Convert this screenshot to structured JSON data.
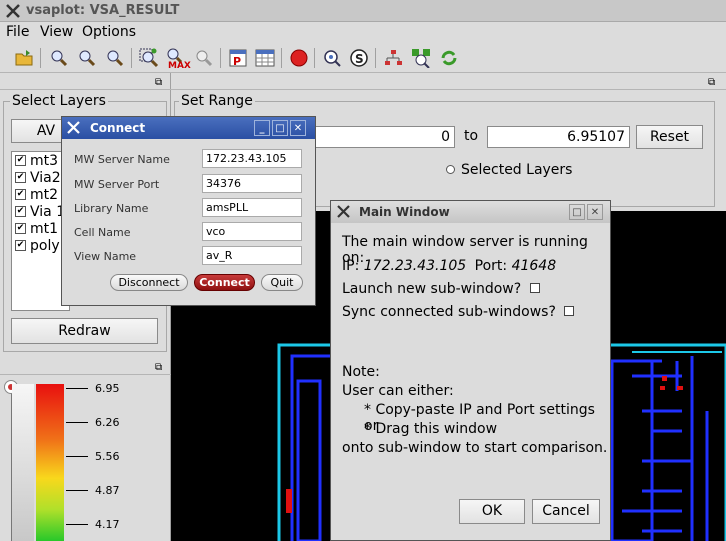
{
  "window": {
    "title": "vsaplot: VSA_RESULT"
  },
  "menu": [
    "File",
    "View",
    "Options"
  ],
  "toolbar": [
    "open-icon",
    "zoom-in-icon",
    "zoom-out-icon",
    "zoom-fit-icon",
    "zoom-area-icon",
    "zoom-max-icon",
    "zoom-prev-icon",
    "print-icon",
    "table-icon",
    "stop-icon",
    "find-icon",
    "select-icon",
    "hierarchy-icon",
    "connect-icon",
    "refresh-icon"
  ],
  "toolbar_max_label": "MAX",
  "left_panel": {
    "title": "Select Layers",
    "av_button": "AV",
    "layers": [
      "mt3",
      "Via2",
      "mt2",
      "Via 1",
      "mt1",
      "poly"
    ],
    "redraw_button": "Redraw"
  },
  "right_panel": {
    "title": "Set Range",
    "from_value": "0",
    "to_label": "to",
    "to_value": "6.95107",
    "reset_button": "Reset",
    "selected_layers_label": "Selected Layers"
  },
  "color_scale": {
    "ticks": [
      "6.95",
      "6.26",
      "5.56",
      "4.87",
      "4.17"
    ]
  },
  "connect_dialog": {
    "title": "Connect",
    "fields": [
      {
        "label": "MW Server Name",
        "value": "172.23.43.105"
      },
      {
        "label": "MW Server Port",
        "value": "34376"
      },
      {
        "label": "Library Name",
        "value": "amsPLL"
      },
      {
        "label": "Cell Name",
        "value": "vco"
      },
      {
        "label": "View Name",
        "value": "av_R"
      }
    ],
    "disconnect_button": "Disconnect",
    "connect_button": "Connect",
    "quit_button": "Quit"
  },
  "main_dialog": {
    "title": "Main Window",
    "line1": "The main window server is running on:",
    "ip_label": "IP:",
    "ip_value": "172.23.43.105",
    "port_label": "Port:",
    "port_value": "41648",
    "launch_label": "Launch new sub-window?",
    "sync_label": "Sync connected sub-windows?",
    "note_title": "Note:",
    "note_line1": "User can either:",
    "note_line2": "* Copy-paste IP and Port settings or",
    "note_line3": "* Drag this window",
    "note_line4": "onto sub-window to start comparison.",
    "ok_button": "OK",
    "cancel_button": "Cancel"
  }
}
